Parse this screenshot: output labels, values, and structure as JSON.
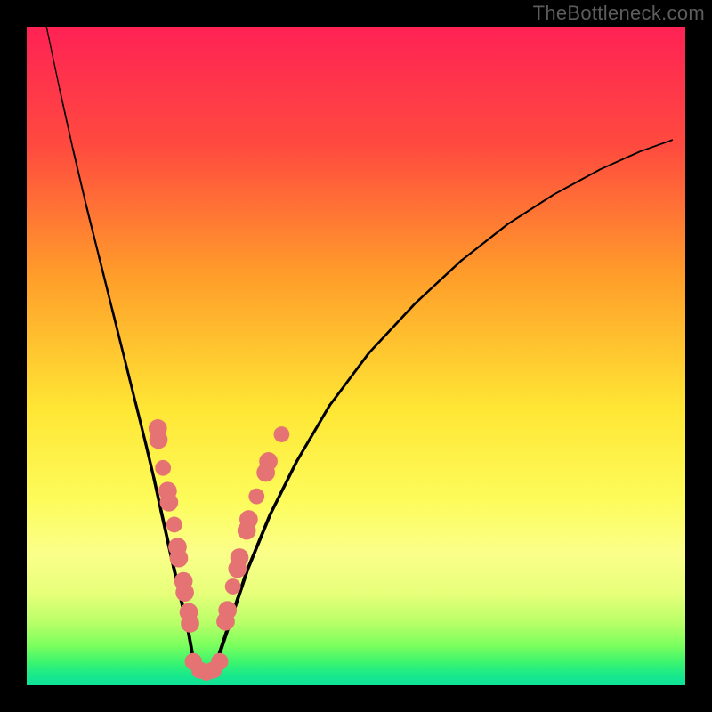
{
  "watermark": "TheBottleneck.com",
  "chart_data": {
    "type": "line",
    "title": "",
    "xlabel": "",
    "ylabel": "",
    "xlim": [
      0,
      100
    ],
    "ylim": [
      0,
      100
    ],
    "grid": false,
    "legend": false,
    "background_gradient": {
      "stops": [
        {
          "offset": 0.0,
          "color": "#ff2255"
        },
        {
          "offset": 0.18,
          "color": "#ff4a3f"
        },
        {
          "offset": 0.38,
          "color": "#ff9e2a"
        },
        {
          "offset": 0.58,
          "color": "#ffe634"
        },
        {
          "offset": 0.72,
          "color": "#fdfc5b"
        },
        {
          "offset": 0.8,
          "color": "#fbff8a"
        },
        {
          "offset": 0.86,
          "color": "#e7ff7a"
        },
        {
          "offset": 0.905,
          "color": "#b9ff68"
        },
        {
          "offset": 0.94,
          "color": "#7aff5e"
        },
        {
          "offset": 0.965,
          "color": "#3cf56e"
        },
        {
          "offset": 0.985,
          "color": "#18e88c"
        },
        {
          "offset": 1.0,
          "color": "#0fe299"
        }
      ]
    },
    "series": [
      {
        "name": "left-branch",
        "x": [
          3,
          5,
          7,
          9,
          11,
          13,
          15,
          16.5,
          18,
          19.3,
          20.4,
          21.4,
          22.3,
          23.1,
          23.8,
          24.4
        ],
        "y": [
          100,
          90.5,
          81.5,
          73,
          65,
          57,
          49,
          43,
          37,
          31.5,
          26.5,
          22,
          18,
          14.5,
          11.5,
          9
        ],
        "stroke": "#000000",
        "weight_profile": "thin-top-thick-bottom"
      },
      {
        "name": "valley-floor",
        "x": [
          24.4,
          25.2,
          26.0,
          26.8,
          27.5
        ],
        "y": [
          9,
          4.5,
          2.2,
          1.4,
          1.2
        ],
        "stroke": "#000000"
      },
      {
        "name": "right-branch",
        "x": [
          27.5,
          29,
          31,
          33.5,
          37,
          41,
          46,
          52,
          59,
          66,
          73,
          80,
          87,
          93,
          98
        ],
        "y": [
          1.2,
          4,
          10,
          17.5,
          26,
          34,
          42.5,
          50.5,
          58,
          64.5,
          70,
          74.5,
          78.3,
          81,
          82.8
        ],
        "stroke": "#000000",
        "weight_profile": "thick-bottom-thin-top"
      }
    ],
    "markers": {
      "color": "#e57373",
      "clusters": [
        {
          "name": "left-arm-dots",
          "points": [
            {
              "x": 19.9,
              "y": 39.0,
              "r": 1.4
            },
            {
              "x": 20.0,
              "y": 37.3,
              "r": 1.4
            },
            {
              "x": 20.7,
              "y": 33.0,
              "r": 1.2
            },
            {
              "x": 21.4,
              "y": 29.5,
              "r": 1.4
            },
            {
              "x": 21.6,
              "y": 27.8,
              "r": 1.4
            },
            {
              "x": 22.4,
              "y": 24.4,
              "r": 1.2
            },
            {
              "x": 22.9,
              "y": 21.0,
              "r": 1.4
            },
            {
              "x": 23.1,
              "y": 19.3,
              "r": 1.4
            },
            {
              "x": 23.8,
              "y": 15.8,
              "r": 1.4
            },
            {
              "x": 24.0,
              "y": 14.1,
              "r": 1.4
            },
            {
              "x": 24.6,
              "y": 11.1,
              "r": 1.4
            },
            {
              "x": 24.8,
              "y": 9.4,
              "r": 1.4
            }
          ]
        },
        {
          "name": "valley-dots",
          "points": [
            {
              "x": 25.3,
              "y": 3.6,
              "r": 1.3
            },
            {
              "x": 26.3,
              "y": 2.3,
              "r": 1.3
            },
            {
              "x": 27.3,
              "y": 2.0,
              "r": 1.3
            },
            {
              "x": 28.3,
              "y": 2.3,
              "r": 1.3
            },
            {
              "x": 29.3,
              "y": 3.6,
              "r": 1.3
            }
          ]
        },
        {
          "name": "right-arm-dots",
          "points": [
            {
              "x": 30.2,
              "y": 9.7,
              "r": 1.4
            },
            {
              "x": 30.5,
              "y": 11.4,
              "r": 1.4
            },
            {
              "x": 31.3,
              "y": 15.0,
              "r": 1.2
            },
            {
              "x": 32.0,
              "y": 17.7,
              "r": 1.4
            },
            {
              "x": 32.3,
              "y": 19.4,
              "r": 1.4
            },
            {
              "x": 33.4,
              "y": 23.5,
              "r": 1.4
            },
            {
              "x": 33.7,
              "y": 25.2,
              "r": 1.4
            },
            {
              "x": 34.9,
              "y": 28.7,
              "r": 1.2
            },
            {
              "x": 36.3,
              "y": 32.3,
              "r": 1.4
            },
            {
              "x": 36.7,
              "y": 34.0,
              "r": 1.4
            },
            {
              "x": 38.7,
              "y": 38.1,
              "r": 1.2
            }
          ]
        }
      ]
    }
  }
}
